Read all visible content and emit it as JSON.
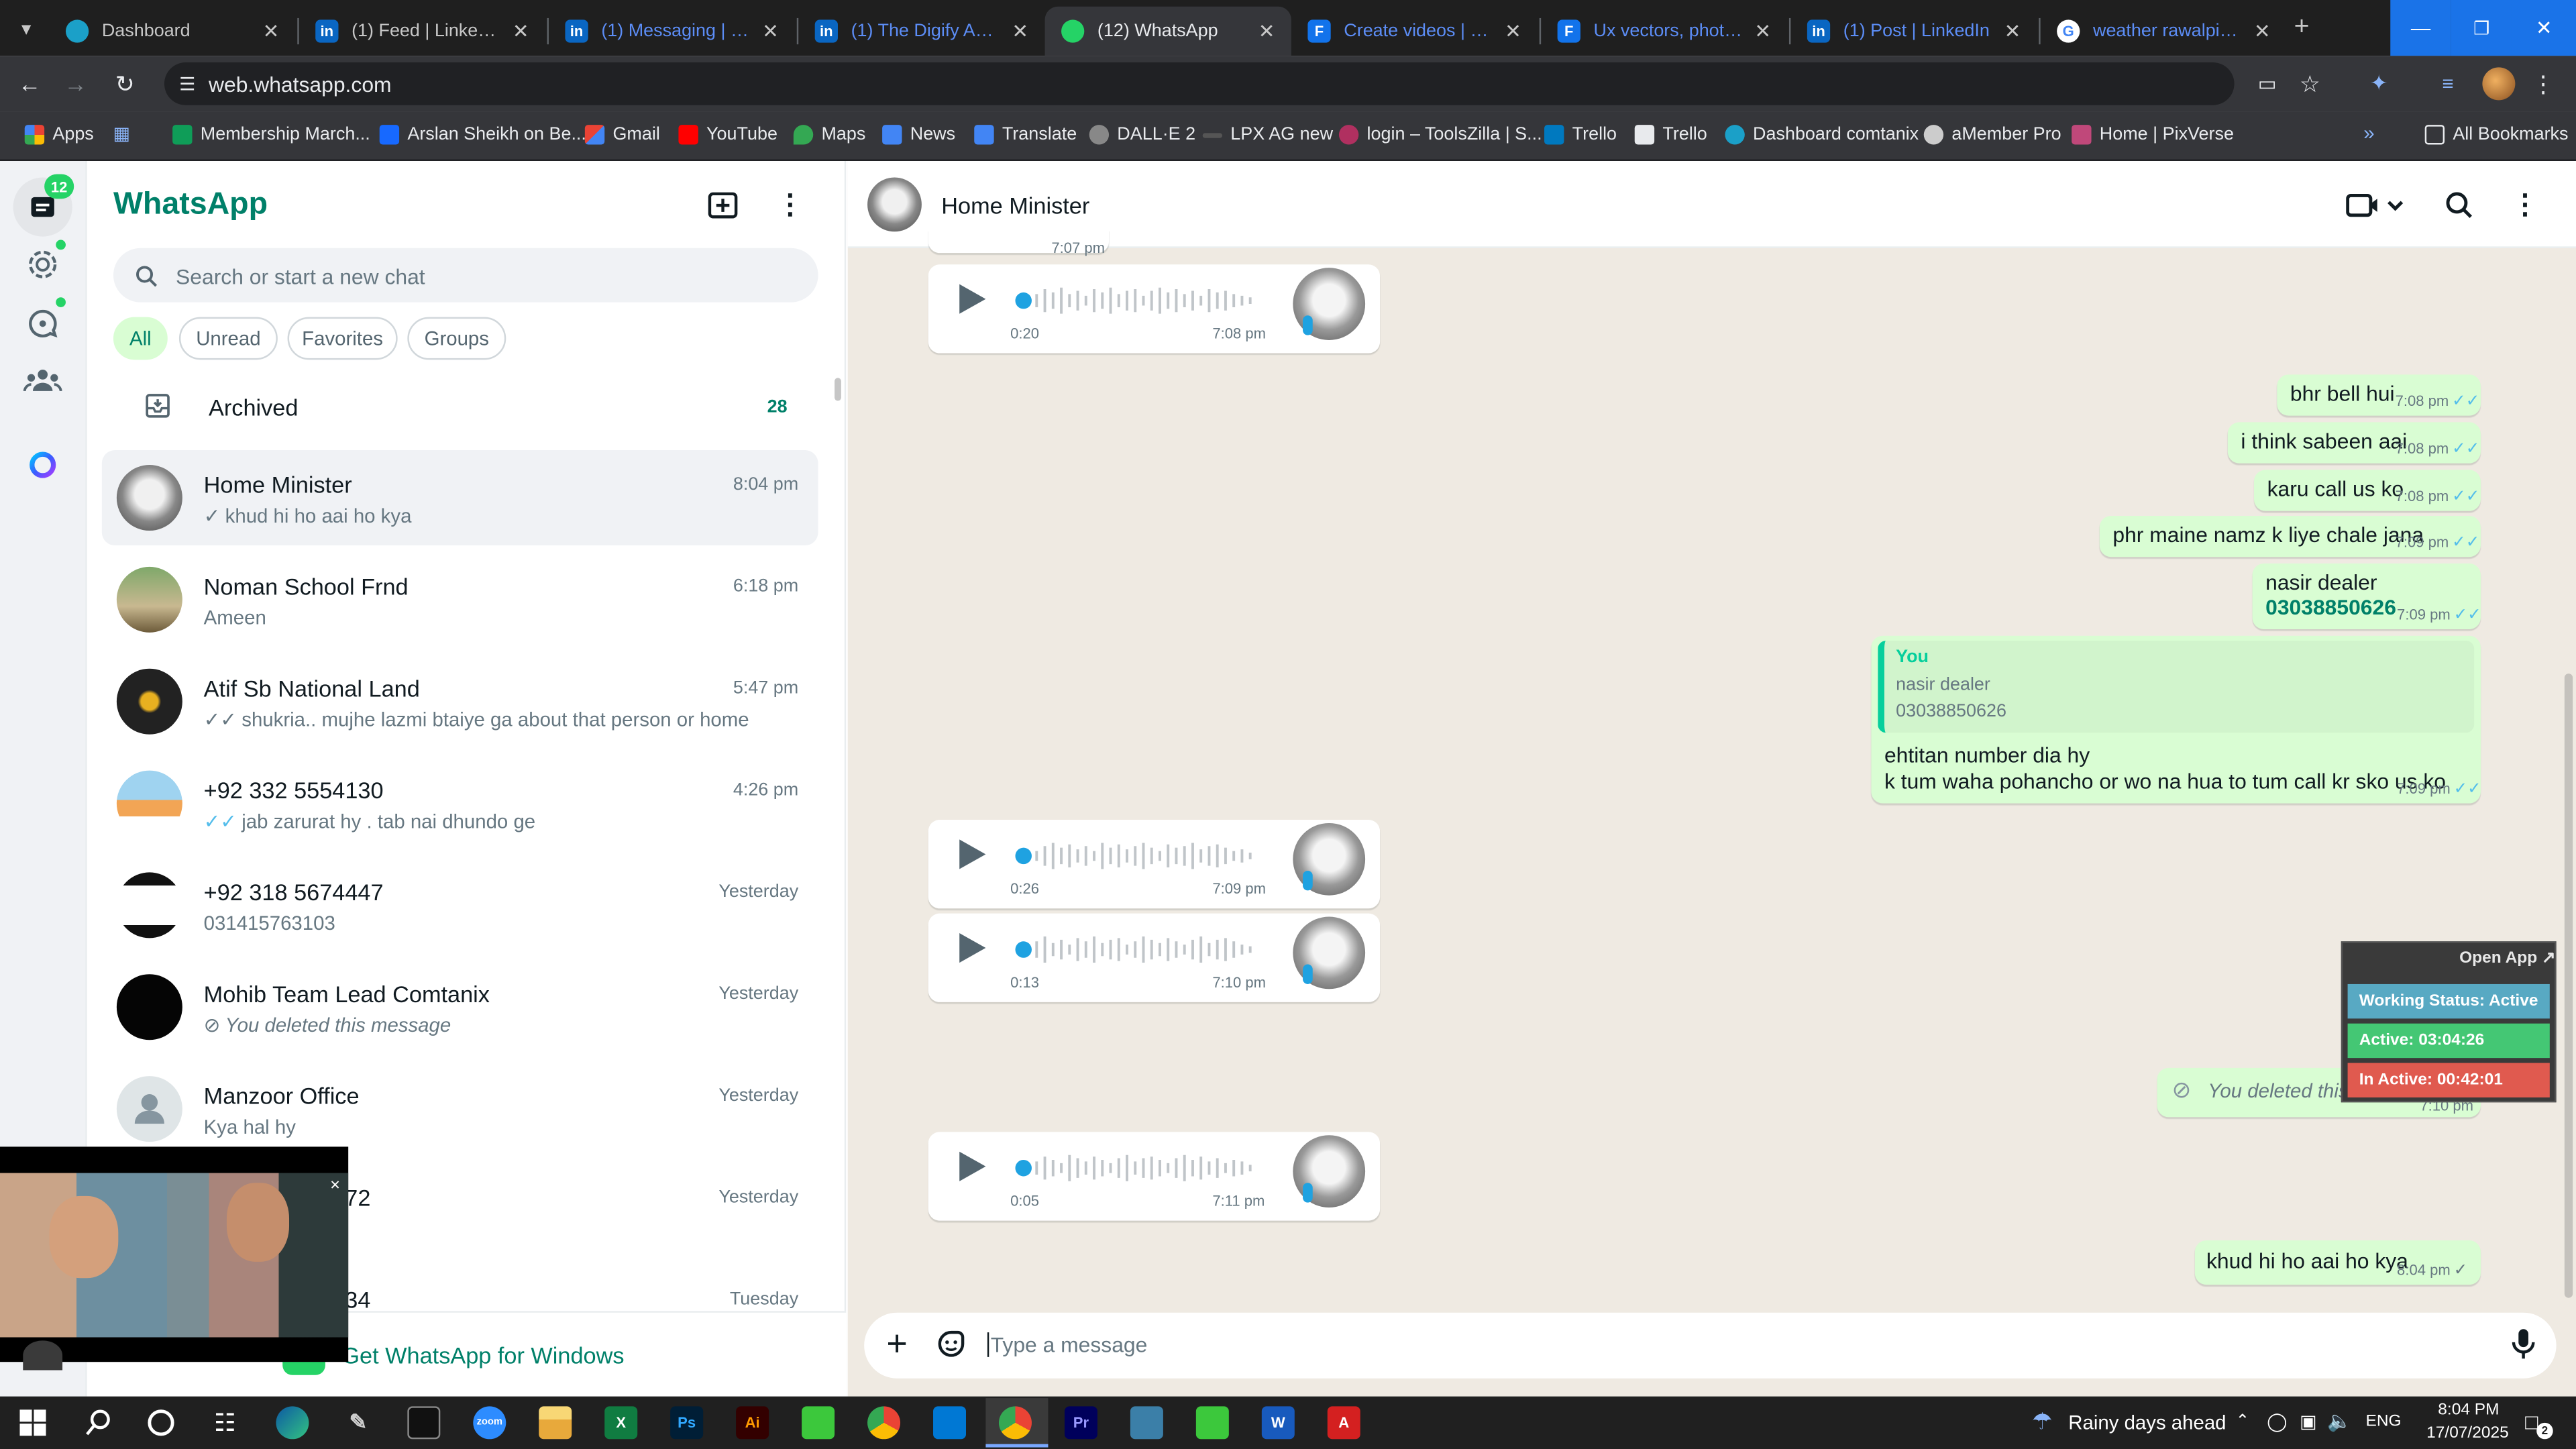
{
  "browser": {
    "tabs": [
      {
        "title": "Dashboard",
        "active": false
      },
      {
        "title": "(1) Feed | LinkedIn",
        "active": false
      },
      {
        "title": "(1) Messaging | LinkedIn",
        "active": false
      },
      {
        "title": "(1) The Digify Agency",
        "active": false
      },
      {
        "title": "(12) WhatsApp",
        "active": true
      },
      {
        "title": "Create videos | Freepik",
        "active": false
      },
      {
        "title": "Ux vectors, photos and",
        "active": false
      },
      {
        "title": "(1) Post | LinkedIn",
        "active": false
      },
      {
        "title": "weather rawalpindi today",
        "active": false
      }
    ],
    "url": "web.whatsapp.com",
    "bookmarks": [
      "Apps",
      "Membership March...",
      "Arslan Sheikh on Be...",
      "Gmail",
      "YouTube",
      "Maps",
      "News",
      "Translate",
      "DALL·E 2",
      "LPX AG new",
      "login – ToolsZilla | S...",
      "Trello",
      "Trello",
      "Dashboard comtanix",
      "aMember Pro",
      "Home | PixVerse"
    ],
    "all_bookmarks": "All Bookmarks"
  },
  "rail": {
    "chats_badge": "12"
  },
  "sidebar": {
    "title": "WhatsApp",
    "search_placeholder": "Search or start a new chat",
    "filters": [
      "All",
      "Unread",
      "Favorites",
      "Groups"
    ],
    "archived_label": "Archived",
    "archived_count": "28",
    "chats": [
      {
        "name": "Home Minister",
        "time": "8:04 pm",
        "preview": "khud hi ho aai ho kya",
        "tick": "single"
      },
      {
        "name": "Noman School Frnd",
        "time": "6:18 pm",
        "preview": "Ameen",
        "tick": "none"
      },
      {
        "name": "Atif Sb National Land",
        "time": "5:47 pm",
        "preview": "shukria.. mujhe lazmi btaiye ga  about that person or home",
        "tick": "double"
      },
      {
        "name": "+92 332 5554130",
        "time": "4:26 pm",
        "preview": "jab zarurat hy . tab nai dhundo ge",
        "tick": "double"
      },
      {
        "name": "+92 318 5674447",
        "time": "Yesterday",
        "preview": "031415763103",
        "tick": "none"
      },
      {
        "name": "Mohib Team Lead Comtanix",
        "time": "Yesterday",
        "preview": "You deleted this message",
        "tick": "deleted"
      },
      {
        "name": "Manzoor Office",
        "time": "Yesterday",
        "preview": "Kya hal hy",
        "tick": "none"
      },
      {
        "name": "72",
        "time": "Yesterday",
        "preview": "",
        "tick": "none"
      },
      {
        "name": "34",
        "time": "Tuesday",
        "preview": "",
        "tick": "none"
      }
    ],
    "get_windows": "Get WhatsApp for Windows"
  },
  "chat": {
    "contact_name": "Home Minister",
    "top_partial_time": "7:07 pm",
    "messages": [
      {
        "type": "voice",
        "dir": "in",
        "duration": "0:20",
        "time": "7:08 pm"
      },
      {
        "type": "text",
        "dir": "out",
        "text": "bhr bell hui",
        "time": "7:08 pm"
      },
      {
        "type": "text",
        "dir": "out",
        "text": "i think sabeen aai",
        "time": "7:08 pm"
      },
      {
        "type": "text",
        "dir": "out",
        "text": "karu call us ko",
        "time": "7:08 pm"
      },
      {
        "type": "text",
        "dir": "out",
        "text": "phr maine namz k liye chale jana",
        "time": "7:09 pm"
      },
      {
        "type": "text",
        "dir": "out",
        "text": "nasir dealer",
        "phone": "03038850626",
        "time": "7:09 pm"
      },
      {
        "type": "reply",
        "dir": "out",
        "quote_author": "You",
        "quote_line1": "nasir dealer",
        "quote_line2": "03038850626",
        "line1": "ehtitan number dia hy",
        "line2": "k tum waha pohancho or wo na hua to tum call kr sko us ko",
        "time": "7:09 pm"
      },
      {
        "type": "voice",
        "dir": "in",
        "duration": "0:26",
        "time": "7:09 pm"
      },
      {
        "type": "voice",
        "dir": "in",
        "duration": "0:13",
        "time": "7:10 pm"
      },
      {
        "type": "deleted",
        "dir": "out",
        "text": "You deleted this message",
        "time": "7:10 pm"
      },
      {
        "type": "voice",
        "dir": "in",
        "duration": "0:05",
        "time": "7:11 pm"
      },
      {
        "type": "text",
        "dir": "out",
        "text": "khud hi ho aai ho kya",
        "time": "8:04 pm"
      }
    ],
    "input_placeholder": "Type a message"
  },
  "overlay_widget": {
    "open_app": "Open App ↗",
    "working_status": "Working Status: Active",
    "active": "Active: 03:04:26",
    "inactive": "In Active: 00:42:01"
  },
  "taskbar": {
    "weather": "Rainy days ahead",
    "lang": "ENG",
    "time": "8:04 PM",
    "date": "17/07/2025",
    "notif_count": "2"
  },
  "colors": {
    "wa_green": "#008069",
    "bubble_out": "#d9fdd3",
    "chat_bg": "#efeae2",
    "read_tick": "#53bdeb"
  }
}
